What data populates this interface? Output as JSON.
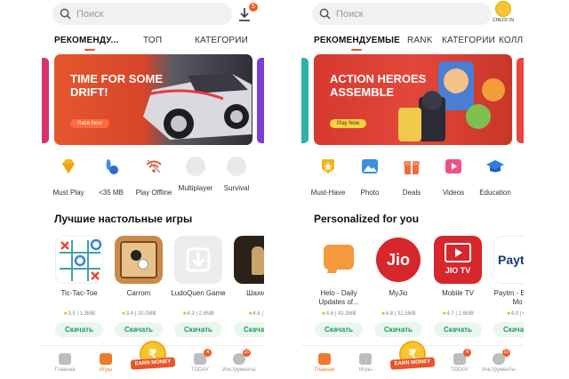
{
  "left": {
    "search": {
      "placeholder": "Поиск"
    },
    "download_badge": "5",
    "tabs": [
      {
        "label": "РЕКОМЕНДУ..."
      },
      {
        "label": "ТОП"
      },
      {
        "label": "КАТЕГОРИИ"
      }
    ],
    "banner": {
      "title": "TIME FOR SOME DRIFT!",
      "button": "Race Now",
      "bg": "#e4572e",
      "accent": "#e63946"
    },
    "categories": [
      {
        "label": "Must Play",
        "icon": "diamond-icon",
        "color": "#f5b51f"
      },
      {
        "label": "<35 MB",
        "icon": "bowling-icon",
        "color": "#3c8fe6"
      },
      {
        "label": "Play Offline",
        "icon": "wifi-off-icon",
        "color": "#e8552a"
      },
      {
        "label": "Multiplayer",
        "icon": "multiplayer-icon",
        "color": "#e5e5e5"
      },
      {
        "label": "Survival",
        "icon": "survival-icon",
        "color": "#e5e5e5"
      }
    ],
    "section_title": "Лучшие настольные игры",
    "apps": [
      {
        "name": "Tic-Tac-Toe",
        "rating": "3.5",
        "size": "1.3MB",
        "button": "Скачать"
      },
      {
        "name": "Carrom",
        "rating": "3.4",
        "size": "20.0MB",
        "button": "Скачать"
      },
      {
        "name": "LudoQuen Game",
        "rating": "4.3",
        "size": "2.6MB",
        "button": "Скачать"
      },
      {
        "name": "Шахма",
        "rating": "4.6",
        "size": "2",
        "button": "Скачать"
      }
    ],
    "nav": [
      {
        "label": "Главная",
        "badge": ""
      },
      {
        "label": "Игры",
        "badge": ""
      },
      {
        "label": "TODAY",
        "badge": "4"
      },
      {
        "label": "Инструменты",
        "badge": "10"
      }
    ],
    "earn_label": "EARN MONEY"
  },
  "right": {
    "search": {
      "placeholder": "Поиск"
    },
    "checkin_label": "CHECK IN",
    "tabs": [
      {
        "label": "РЕКОМЕНДУЕМЫЕ"
      },
      {
        "label": "RANK"
      },
      {
        "label": "КАТЕГОРИИ"
      },
      {
        "label": "КОЛЛ"
      }
    ],
    "banner": {
      "title": "ACTION HEROES ASSEMBLE",
      "button": "Play Now",
      "bg": "#d63a2f",
      "accent": "#2ab3a6"
    },
    "categories": [
      {
        "label": "Must-Have",
        "icon": "badge-icon",
        "color": "#f5b51f"
      },
      {
        "label": "Photo",
        "icon": "photo-icon",
        "color": "#3c8fe6"
      },
      {
        "label": "Deals",
        "icon": "gift-icon",
        "color": "#f06a3c"
      },
      {
        "label": "Videos",
        "icon": "play-icon",
        "color": "#f0508a"
      },
      {
        "label": "Education",
        "icon": "graduation-cap-icon",
        "color": "#2b7de0"
      }
    ],
    "section_title": "Personalized for you",
    "apps": [
      {
        "name": "Helo - Daily Updates of...",
        "rating": "4.6",
        "size": "43.3MB",
        "button": "Скачать"
      },
      {
        "name": "MyJio",
        "rating": "4.8",
        "size": "32.5MB",
        "button": "Скачать"
      },
      {
        "name": "Mobile TV",
        "rating": "4.7",
        "size": "2.6MB",
        "button": "Скачать"
      },
      {
        "name": "Paytm - B UPI, Mo",
        "rating": "4.9",
        "size": "61",
        "button": "Скачать"
      }
    ],
    "app_icon_text": [
      "",
      "Jio",
      "JIO TV",
      "Payt"
    ],
    "nav": [
      {
        "label": "Главная",
        "badge": ""
      },
      {
        "label": "Игры",
        "badge": ""
      },
      {
        "label": "TODAY",
        "badge": "4"
      },
      {
        "label": "Инструменты",
        "badge": "10"
      }
    ],
    "earn_label": "EARN MONEY"
  }
}
